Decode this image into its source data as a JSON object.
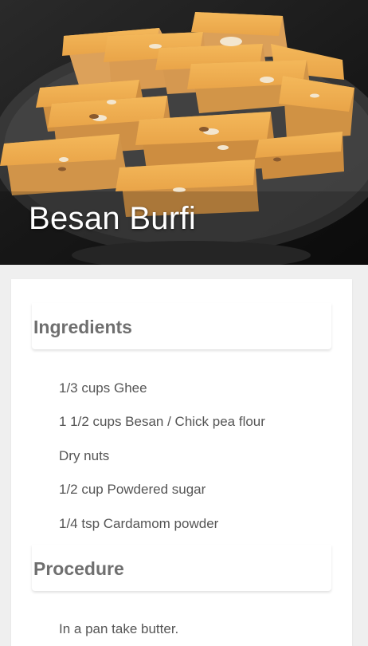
{
  "recipe": {
    "title": "Besan Burfi"
  },
  "ingredients": {
    "heading": "Ingredients",
    "items": [
      "1/3 cups Ghee",
      "1 1/2 cups Besan / Chick pea flour",
      "Dry nuts",
      "1/2 cup Powdered sugar",
      "1/4 tsp Cardamom powder"
    ]
  },
  "procedure": {
    "heading": "Procedure",
    "steps": [
      "In a pan take butter."
    ]
  },
  "colors": {
    "background": "#efefef",
    "card": "#ffffff",
    "heading_text": "#6f6f6f",
    "body_text": "#555555",
    "title_text": "#ffffff"
  }
}
